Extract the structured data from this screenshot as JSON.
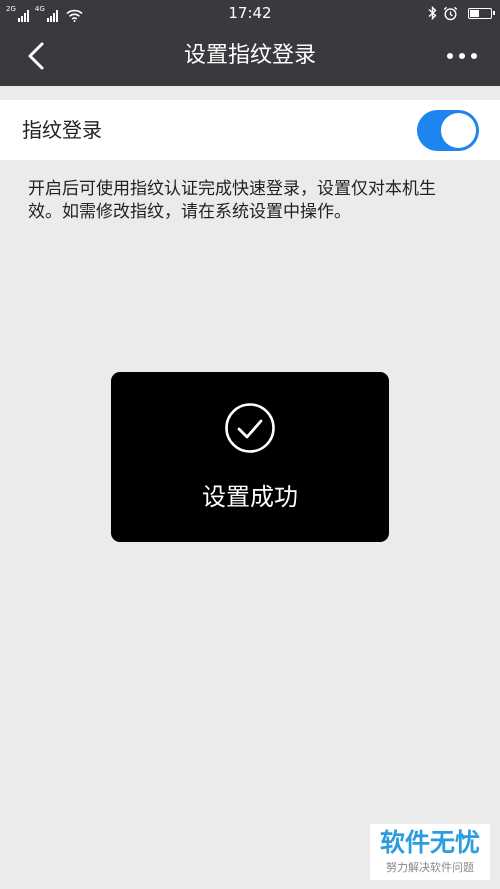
{
  "status_bar": {
    "sim1_label": "2G",
    "sim2_label": "4G",
    "time": "17:42",
    "battery_level": 0.45,
    "icons": [
      "signal-icon",
      "signal-icon",
      "wifi-icon",
      "bluetooth-icon",
      "alarm-icon",
      "battery-icon"
    ]
  },
  "title_bar": {
    "title": "设置指纹登录",
    "back_icon": "chevron-left-icon",
    "more_icon": "more-horizontal-icon",
    "background": "#393a3e"
  },
  "setting": {
    "label": "指纹登录",
    "toggle_on": true,
    "toggle_color": "#1e84f0"
  },
  "description": "开启后可使用指纹认证完成快速登录，设置仅对本机生效。如需修改指纹，请在系统设置中操作。",
  "toast": {
    "icon": "check-circle-icon",
    "text": "设置成功"
  },
  "watermark": {
    "main": "软件无忧",
    "sub": "努力解决软件问题",
    "color": "#2a9de0"
  }
}
